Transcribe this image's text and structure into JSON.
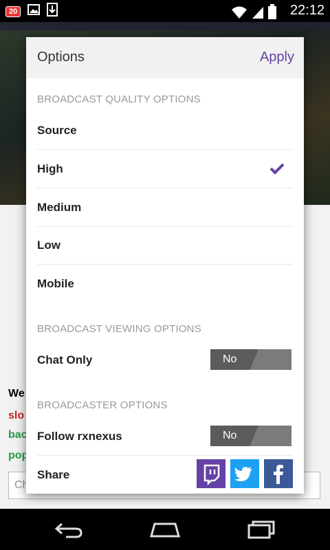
{
  "statusbar": {
    "notification_count": "20",
    "time": "22:12",
    "icons": [
      "notification-badge",
      "image-icon",
      "download-icon",
      "wifi-icon",
      "signal-icon",
      "battery-icon"
    ]
  },
  "background": {
    "chat_lines": [
      {
        "text": "We",
        "color": "#222222"
      },
      {
        "text": "slo",
        "color": "#cc2222"
      },
      {
        "text": "bac",
        "color": "#2a9a4a"
      },
      {
        "text": "pop",
        "color": "#2a9a4a"
      }
    ],
    "chat_input_placeholder": "Ch"
  },
  "dialog": {
    "title": "Options",
    "apply_label": "Apply",
    "quality_section": "BROADCAST QUALITY OPTIONS",
    "quality_options": [
      "Source",
      "High",
      "Medium",
      "Low",
      "Mobile"
    ],
    "selected_quality": "High",
    "viewing_section": "BROADCAST VIEWING OPTIONS",
    "chat_only_label": "Chat Only",
    "chat_only_value": "No",
    "broadcaster_section": "BROADCASTER OPTIONS",
    "follow_label": "Follow rxnexus",
    "follow_value": "No",
    "share_label": "Share"
  },
  "colors": {
    "accent": "#6441a5",
    "twitch": "#6441a5",
    "twitter": "#1da1f2",
    "facebook": "#3b5998"
  },
  "share_icons": [
    "twitch-icon",
    "twitter-icon",
    "facebook-icon"
  ],
  "navbar_icons": [
    "back-icon",
    "home-icon",
    "recents-icon"
  ]
}
